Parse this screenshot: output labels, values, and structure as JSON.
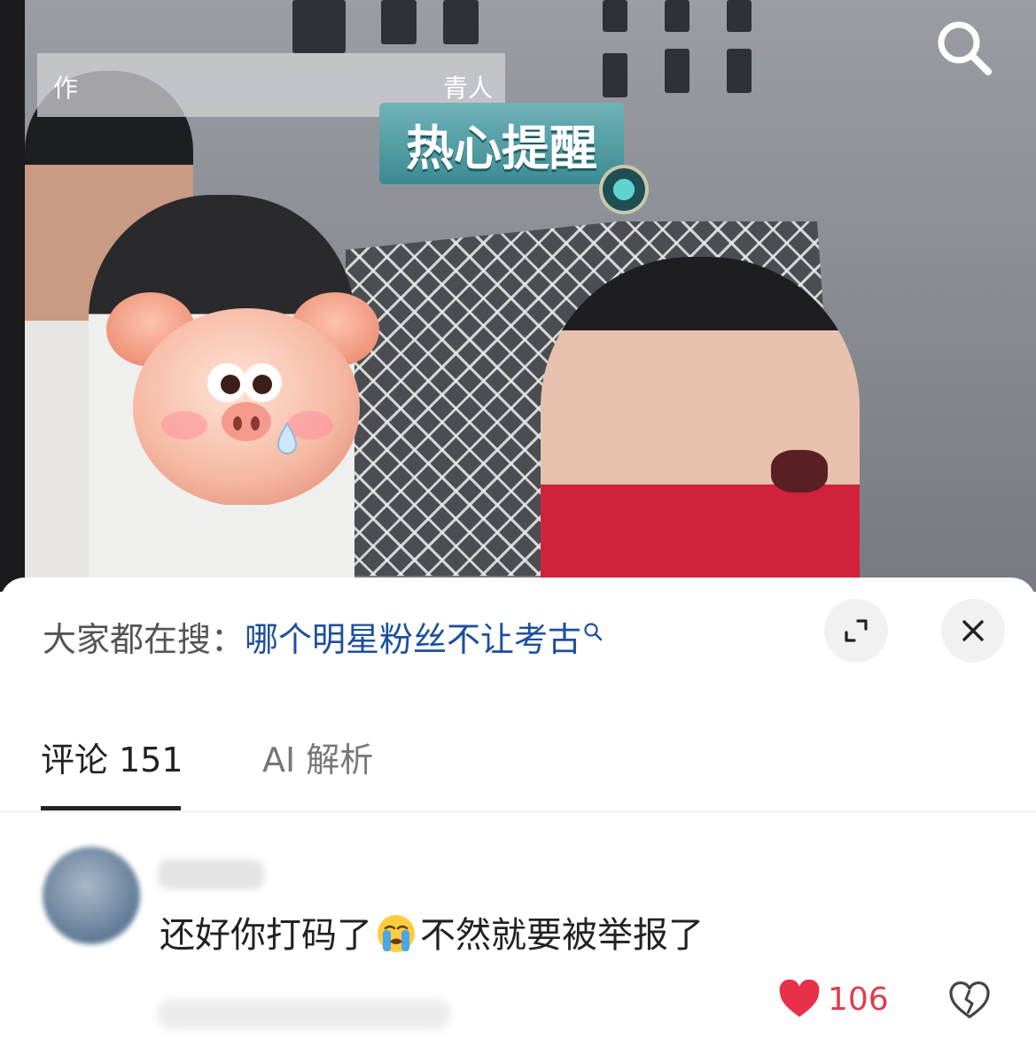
{
  "video": {
    "caption_left": "作",
    "caption_right": "青人",
    "sticker_text": "热心提醒",
    "icons": [
      "search-icon"
    ]
  },
  "hot_search": {
    "label": "大家都在搜：",
    "query": "哪个明星粉丝不让考古"
  },
  "tabs": [
    {
      "label": "评论 151",
      "active": true
    },
    {
      "label": "AI 解析",
      "active": false
    }
  ],
  "comment": {
    "text_before_emoji": "还好你打码了",
    "emoji": "loudly-crying-face",
    "text_after_emoji": "不然就要被举报了",
    "like_count": "106"
  },
  "colors": {
    "link_blue": "#1d4f9c",
    "like_red": "#e33b4f"
  }
}
